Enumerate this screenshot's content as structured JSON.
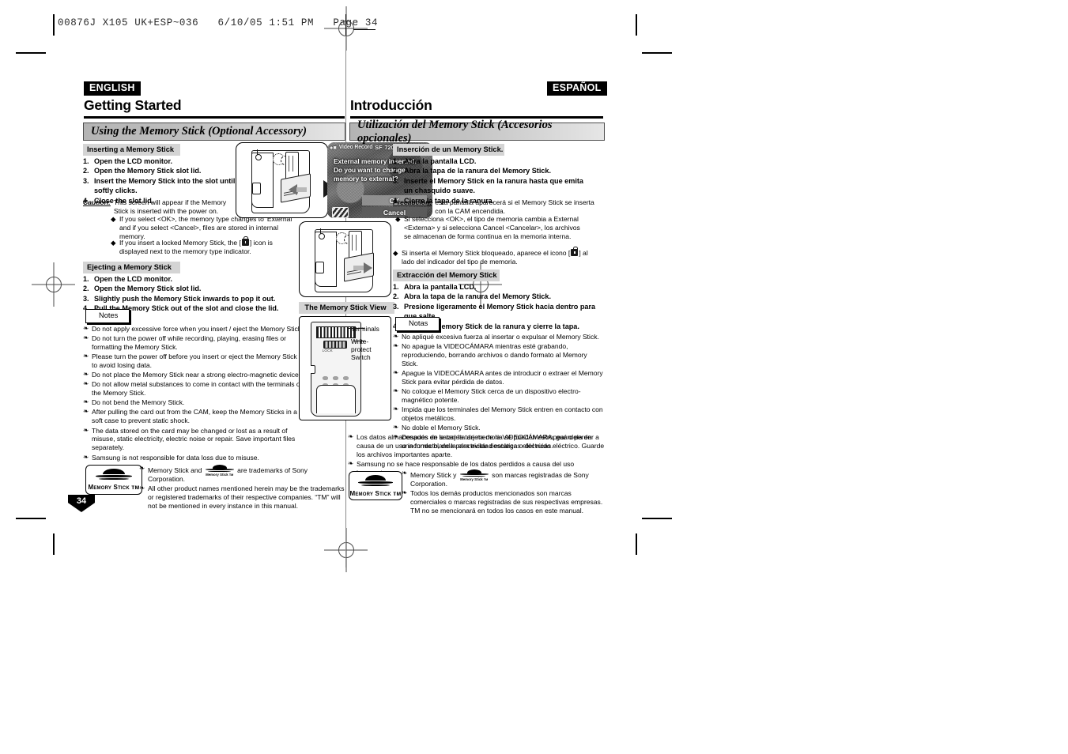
{
  "slug": "00876J X105 UK+ESP~036   6/10/05 1:51 PM   Page 34",
  "page_number": "34",
  "left": {
    "lang_tag": "ENGLISH",
    "chapter_title": "Getting Started",
    "section_band": "Using the Memory Stick (Optional Accessory)",
    "insert": {
      "heading": "Inserting a Memory Stick",
      "steps": [
        "Open the LCD monitor.",
        "Open the Memory Stick slot lid.",
        "Insert the Memory Stick into the slot until it softly clicks.",
        "Close the slot lid."
      ],
      "caution_label": "Caution:",
      "caution_text": "This screen will appear if the Memory Stick is inserted with the power on.",
      "caution_bullets": [
        "If you select <OK>, the memory type changes to 'External' and if you select <Cancel>, files are stored in internal memory.",
        "If you insert a locked Memory Stick, the [ \u0000 ] icon is displayed next to the memory type indicator."
      ]
    },
    "eject": {
      "heading": "Ejecting a Memory Stick",
      "steps": [
        "Open the LCD monitor.",
        "Open the Memory Stick slot lid.",
        "Slightly push the Memory Stick inwards to pop it out.",
        "Pull the Memory Stick out of the slot and close the lid."
      ]
    },
    "notes_label": "Notes",
    "notes": [
      "Do not apply excessive force when you insert / eject the Memory Stick.",
      "Do not turn the power off while recording, playing, erasing files or formatting the Memory Stick.",
      "Please turn the power off before you insert or eject the Memory Stick to avoid losing data.",
      "Do not place the Memory Stick near a strong electro-magnetic device.",
      "Do not allow metal substances to come in contact with the terminals on the Memory Stick.",
      "Do not bend the Memory Stick.",
      "After pulling the card out from the CAM, keep the Memory Sticks in a soft case to prevent static shock.",
      "The data stored on the card may be changed or lost as a result of misuse, static electricity, electric noise or repair. Save important files separately.",
      "Samsung is not responsible for data loss due to misuse."
    ],
    "trademark": [
      "Memory Stick and \u0000 are trademarks of Sony Corporation.",
      "All other product names mentioned herein may be the trademarks or registered trademarks of their respective companies. “TM” will not be mentioned in every instance in this manual."
    ],
    "trademark_part1": "Memory Stick and",
    "trademark_part2": "are trademarks of Sony Corporation."
  },
  "right": {
    "lang_tag": "ESPAÑOL",
    "chapter_title": "Introducción",
    "section_band": "Utilización del Memory Stick (Accesorios opcionales)",
    "insert": {
      "heading": "Inserción de un Memory Stick.",
      "steps": [
        "Abra la pantalla LCD.",
        "Abra la tapa de la ranura del Memory Stick.",
        "Inserte el Memory Stick en la ranura hasta que emita un chasquido suave.",
        "Cierre la tapa de la ranura."
      ],
      "caution_label": "Precaución:",
      "caution_text": "esta pantalla aparecerá si el Memory Stick se inserta con la CAM encendida.",
      "caution_bullets": [
        "Si selecciona <OK>, el tipo de memoria cambia a External <Externa> y si selecciona Cancel <Cancelar>, los archivos se almacenan de forma continua en la memoria interna.",
        "Si inserta el Memory Stick bloqueado, aparece el icono [ \u0000 ] al lado del indicador del tipo de memoria."
      ]
    },
    "eject": {
      "heading": "Extracción del Memory Stick",
      "steps": [
        "Abra la pantalla LCD.",
        "Abra la tapa de la ranura del Memory Stick.",
        "Presione ligeramente el Memory Stick hacia dentro para que salte.",
        "Saque el Memory Stick de la ranura y cierre la tapa."
      ]
    },
    "notes_label": "Notas",
    "notes": [
      "No apliqué excesiva fuerza al insertar o expulsar el Memory Stick.",
      "No apague la VIDEOCÁMARA mientras esté grabando, reproduciendo, borrando archivos o dando formato al Memory Stick.",
      "Apague la VIDEOCÁMARA antes de introducir o extraer el Memory Stick para evitar pérdida de datos.",
      "No coloque el Memory Stick cerca de un dispositivo electro-magnético potente.",
      "Impida que los terminales del Memory Stick entren en contacto con objetos metálicos.",
      "No doble el Memory Stick.",
      "Después de sacar la tarjeta de la VIDEOCÁMARA, guárdela en una funda blanda para evitar descargas eléctricas."
    ],
    "notes_wide": [
      "Los datos almacenados en la tarjeta de memoria se pueden estropear o perder a causa de un uso incorrecto, de la electricidad estática o del ruido eléctrico. Guarde los archivos importantes aparte.",
      "Samsung no se hace responsable de los datos perdidos a causa del uso incorrecto."
    ],
    "trademark_part1": "Memory Stick y",
    "trademark_part2": "son marcas registradas de Sony Corporation.",
    "trademark_bullet2": "Todos los demás productos mencionados son marcas comerciales o marcas registradas de sus respectivas empresas. TM no se mencionará en todos los casos en este manual."
  },
  "lcd": {
    "osd_mode": "Video Record",
    "osd_quality": "SF",
    "osd_size": "720",
    "message_line1": "External memory inserted.",
    "message_line2": "Do you want to change",
    "message_line3": "memory to external?",
    "ok_label": "OK",
    "cancel_label": "Cancel"
  },
  "msview": {
    "title": "The Memory Stick View",
    "label_terminals": "Terminals",
    "label_switch": "Write-\nprotect\nSwitch",
    "card_lock_text": "LOCK"
  },
  "logo": {
    "wordmark": "Memory Stick ᴛᴍ"
  },
  "colors": {
    "band_grey": "#c2c2c2",
    "subhead_grey": "#d4d4d4",
    "ink": "#000000"
  }
}
